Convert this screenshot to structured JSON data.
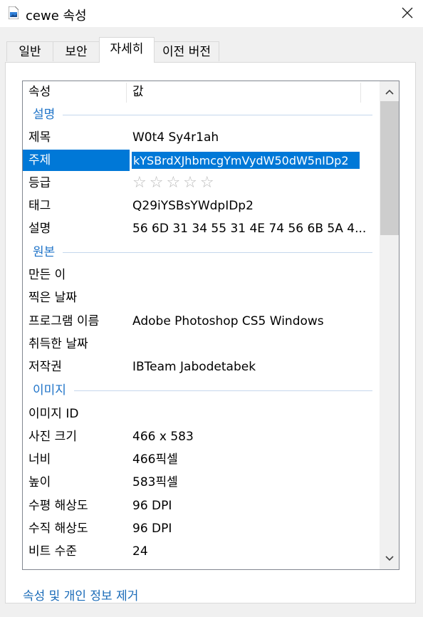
{
  "window": {
    "title": "cewe 속성",
    "icon": "image-file-icon",
    "close_icon": "close-icon"
  },
  "tabs": [
    {
      "label": "일반",
      "active": false
    },
    {
      "label": "보안",
      "active": false
    },
    {
      "label": "자세히",
      "active": true
    },
    {
      "label": "이전 버전",
      "active": false
    }
  ],
  "list": {
    "columns": {
      "property": "속성",
      "value": "값"
    },
    "groups": {
      "description": "설명",
      "origin": "원본",
      "image": "이미지"
    },
    "rows": {
      "title": {
        "name": "제목",
        "value": "W0t4 Sy4r1ah"
      },
      "subject": {
        "name": "주제",
        "value": "kYSBrdXJhbmcgYmVydW50dW5nIDp2"
      },
      "rating": {
        "name": "등급",
        "stars": "☆☆☆☆☆",
        "rating": 0
      },
      "tags": {
        "name": "태그",
        "value": "Q29iYSBsYWdpIDp2"
      },
      "comments": {
        "name": "설명",
        "value": "56 6D 31 34 55 31 4E 74 56 6B 5A 4..."
      },
      "author": {
        "name": "만든 이",
        "value": ""
      },
      "date_taken": {
        "name": "찍은 날짜",
        "value": ""
      },
      "program": {
        "name": "프로그램 이름",
        "value": "Adobe Photoshop CS5 Windows"
      },
      "date_acquired": {
        "name": "취득한 날짜",
        "value": ""
      },
      "copyright": {
        "name": "저작권",
        "value": "IBTeam Jabodetabek"
      },
      "image_id": {
        "name": "이미지 ID",
        "value": ""
      },
      "dimensions": {
        "name": "사진 크기",
        "value": "466 x 583"
      },
      "width": {
        "name": "너비",
        "value": "466픽셀"
      },
      "height": {
        "name": "높이",
        "value": "583픽셀"
      },
      "h_res": {
        "name": "수평 해상도",
        "value": "96 DPI"
      },
      "v_res": {
        "name": "수직 해상도",
        "value": "96 DPI"
      },
      "bit_depth": {
        "name": "비트 수준",
        "value": "24"
      }
    }
  },
  "footer": {
    "remove_link": "속성 및 개인 정보 제거"
  },
  "colors": {
    "accent": "#0078d7",
    "group_text": "#1e73c8",
    "link": "#1a6bb8"
  }
}
